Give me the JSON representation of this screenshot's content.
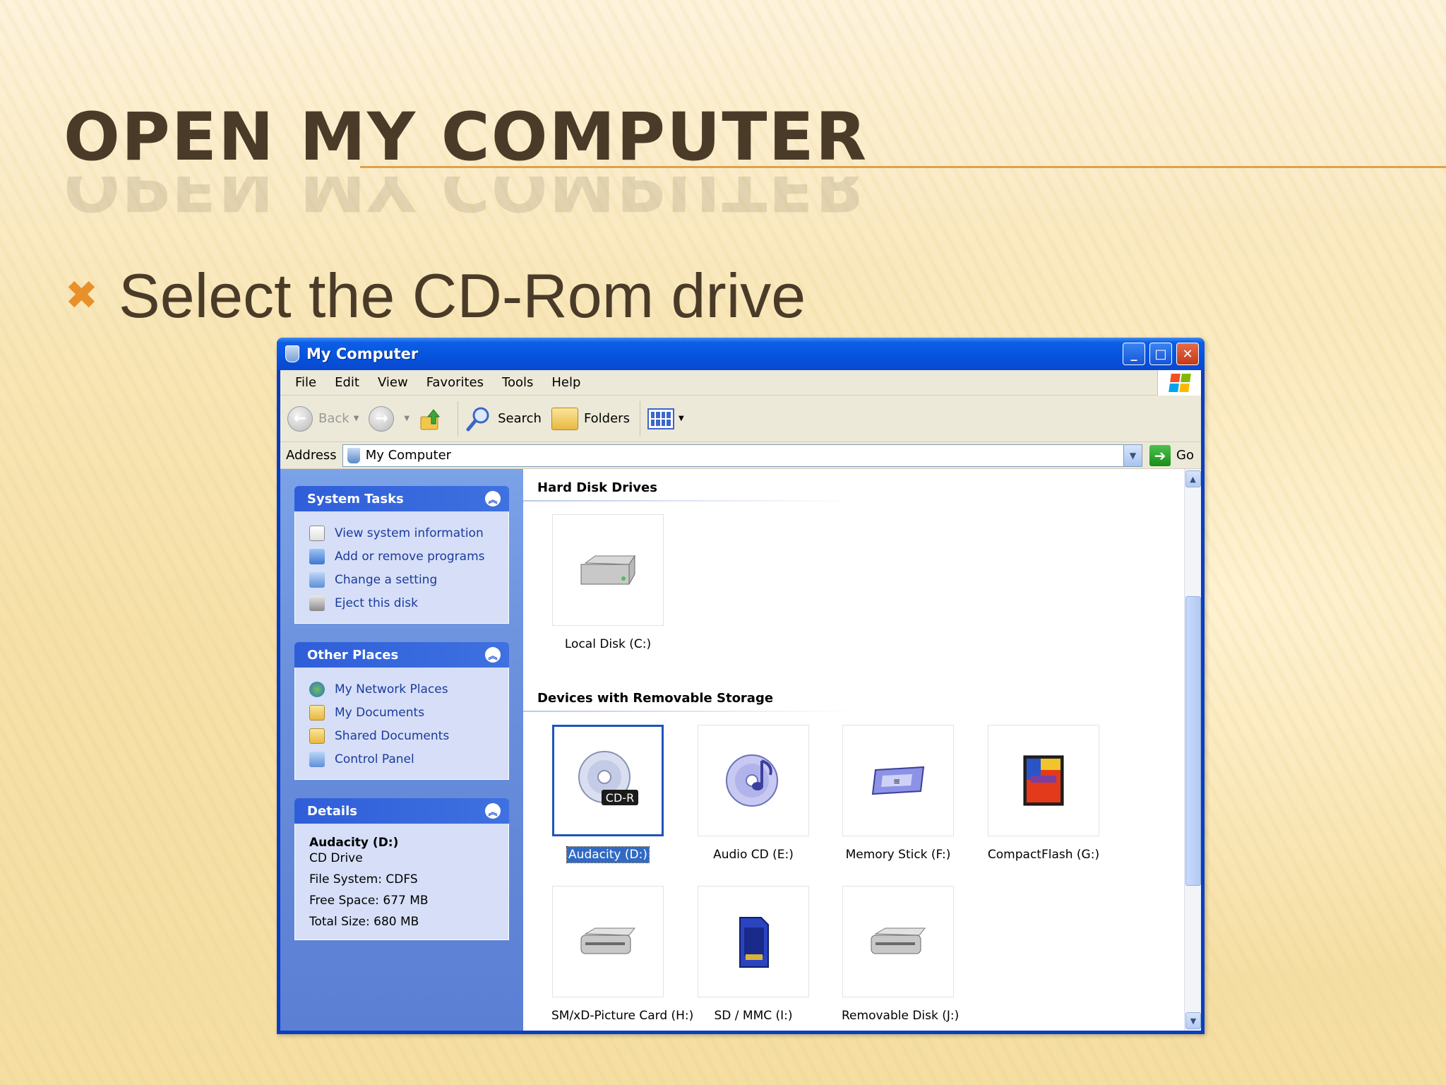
{
  "slide": {
    "title": "OPEN MY COMPUTER",
    "bullet_mark": "✖",
    "bullet_text": "Select the CD-Rom drive"
  },
  "window": {
    "title": "My Computer",
    "menu": [
      "File",
      "Edit",
      "View",
      "Favorites",
      "Tools",
      "Help"
    ],
    "toolbar": {
      "back": "Back",
      "search": "Search",
      "folders": "Folders"
    },
    "address": {
      "label": "Address",
      "value": "My Computer",
      "go": "Go"
    }
  },
  "taskpane": {
    "system_tasks": {
      "title": "System Tasks",
      "items": [
        "View system information",
        "Add or remove programs",
        "Change a setting",
        "Eject this disk"
      ]
    },
    "other_places": {
      "title": "Other Places",
      "items": [
        "My Network Places",
        "My Documents",
        "Shared Documents",
        "Control Panel"
      ]
    },
    "details": {
      "title": "Details",
      "name": "Audacity (D:)",
      "type": "CD Drive",
      "file_system": "File System: CDFS",
      "free_space": "Free Space: 677 MB",
      "total_size": "Total Size: 680 MB"
    }
  },
  "content": {
    "hard_disk_title": "Hard Disk Drives",
    "removable_title": "Devices with Removable Storage",
    "drives": {
      "c": "Local Disk (C:)",
      "d": "Audacity (D:)",
      "e": "Audio CD (E:)",
      "f": "Memory Stick (F:)",
      "g": "CompactFlash (G:)",
      "h": "SM/xD-Picture Card (H:)",
      "i": "SD / MMC (I:)",
      "j": "Removable Disk (J:)"
    },
    "cd_badge": "CD-R"
  },
  "colors": {
    "title_text": "#4a3b29",
    "accent": "#e8912b",
    "xp_blue": "#0a3ec2",
    "selection": "#316ac5"
  }
}
